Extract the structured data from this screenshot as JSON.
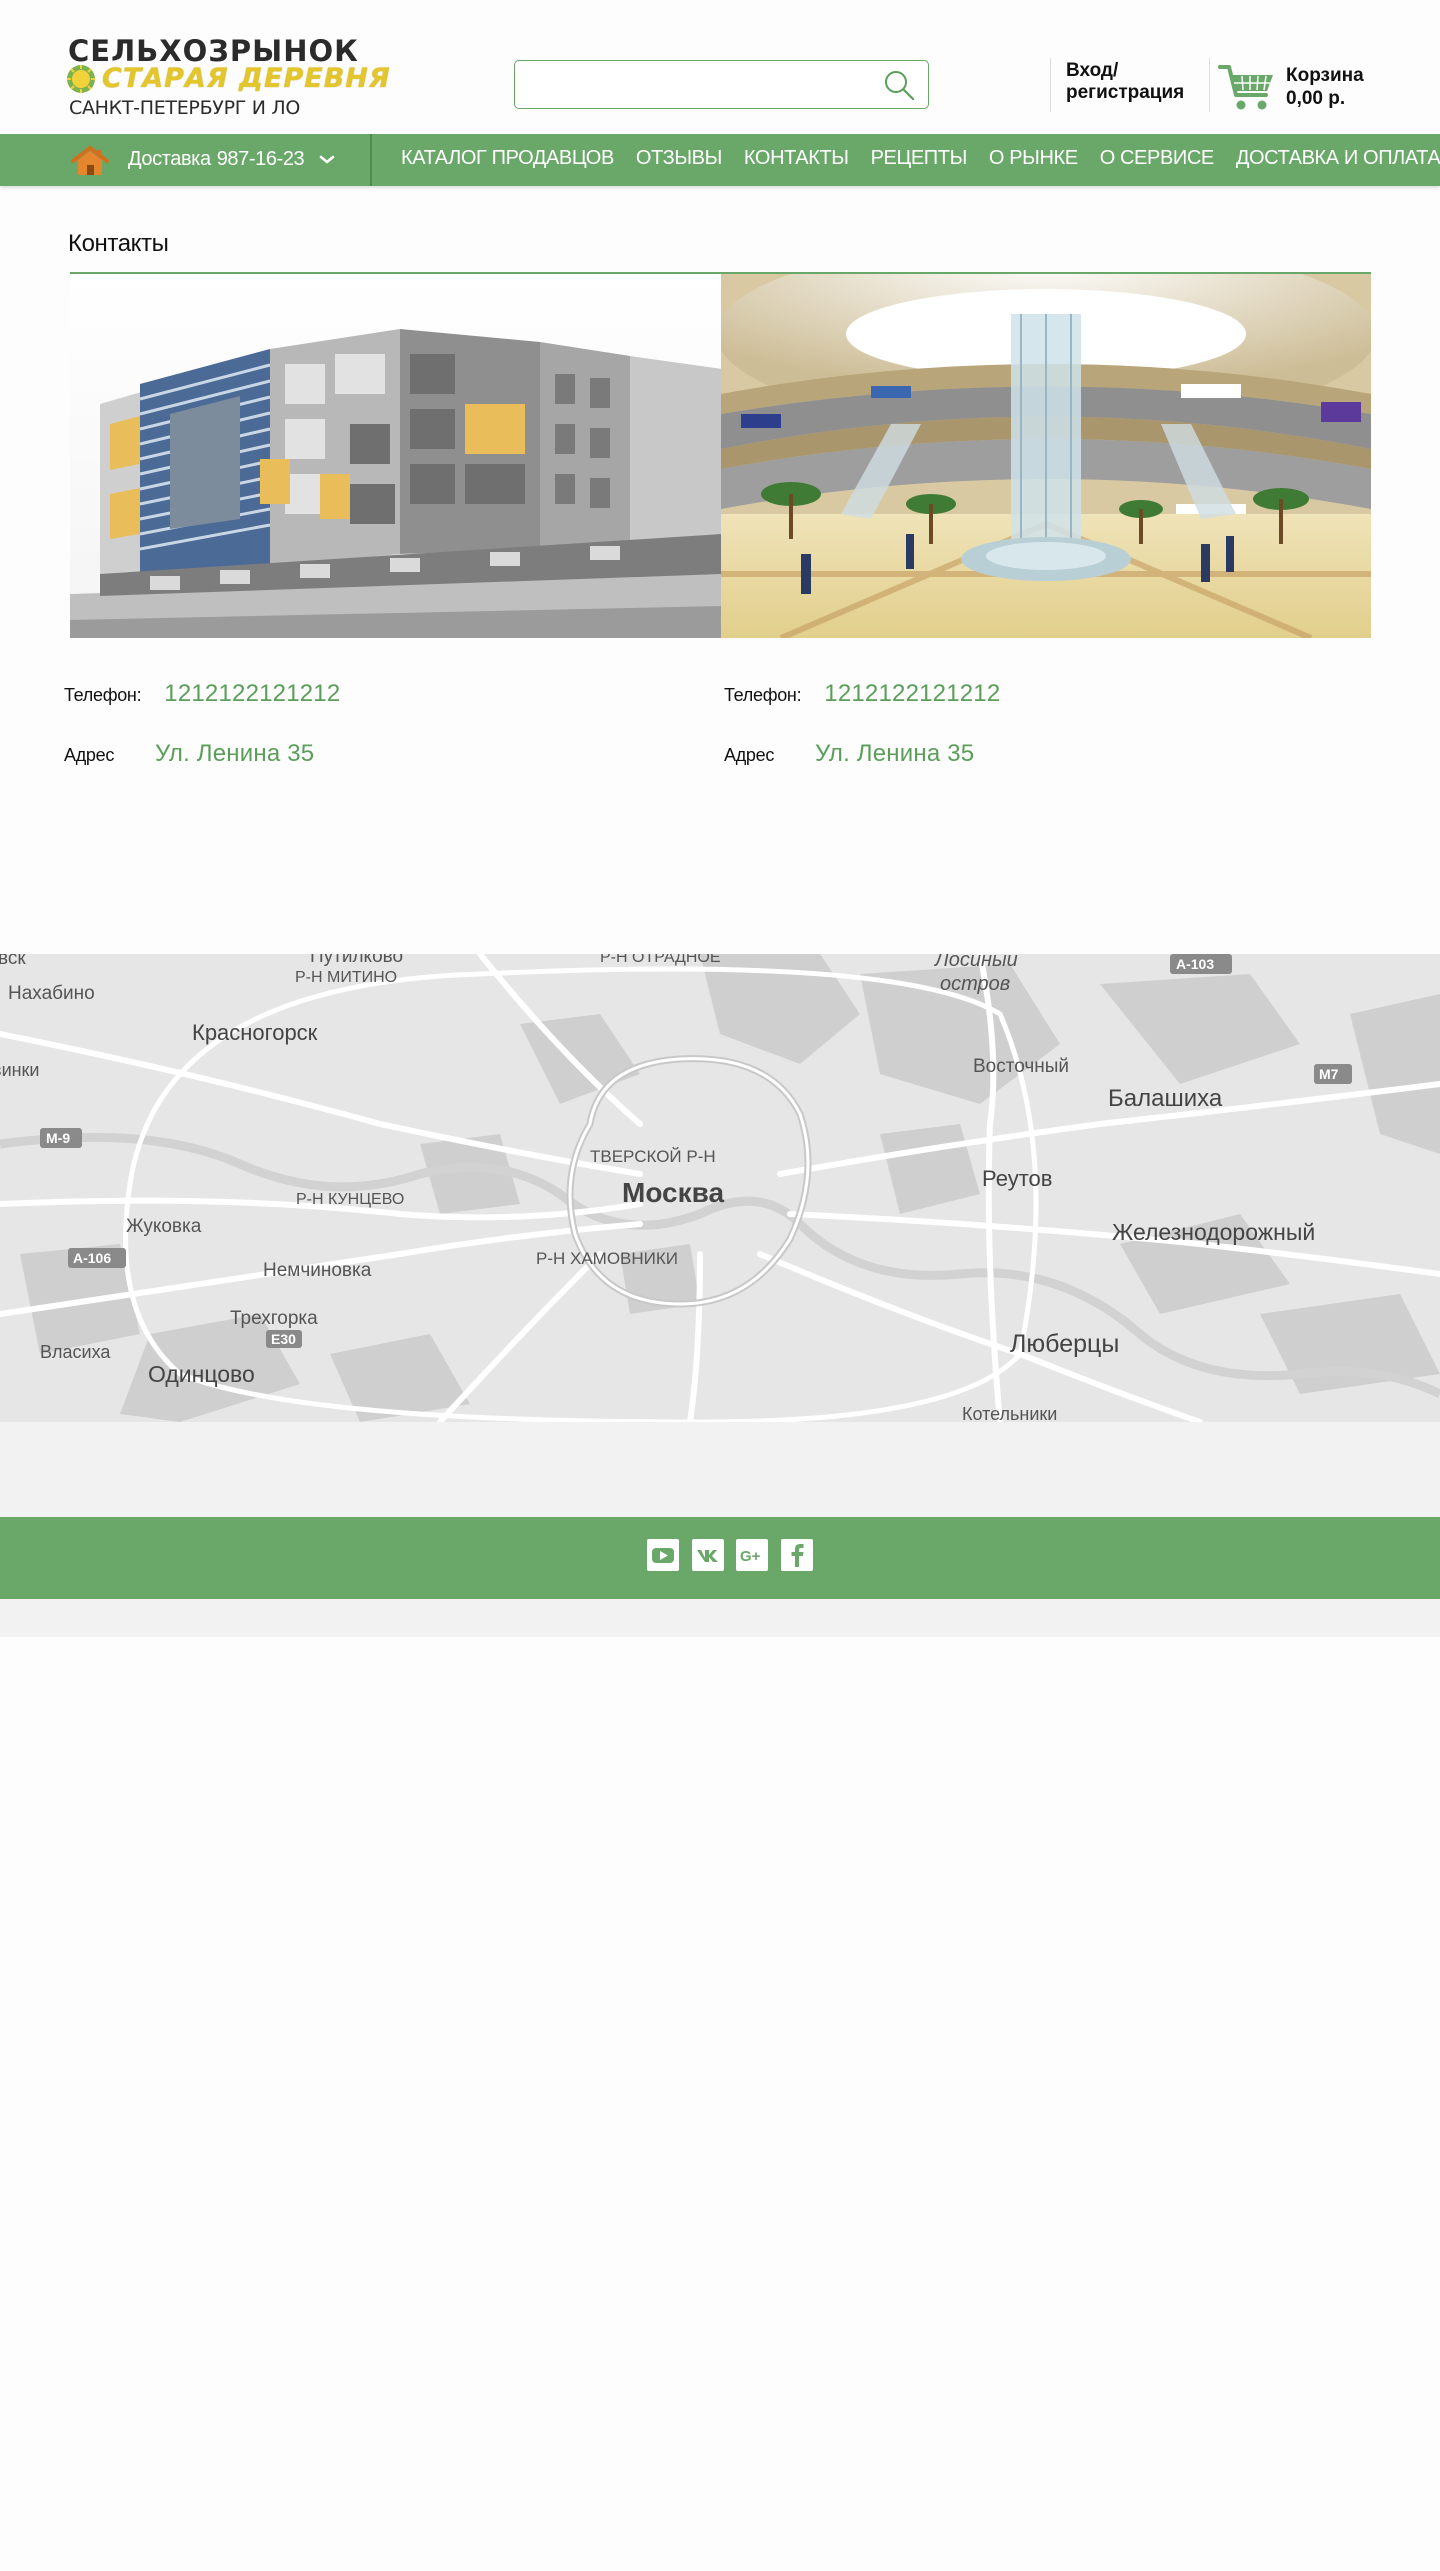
{
  "brand": {
    "line1": "СЕЛЬХОЗРЫНОК",
    "line2": "СТАРАЯ ДЕРЕВНЯ",
    "line3": "САНКТ-ПЕТЕРБУРГ И ЛО"
  },
  "search": {
    "value": "",
    "placeholder": ""
  },
  "account": {
    "line1": "Вход/",
    "line2": "регистрация"
  },
  "cart": {
    "label": "Корзина",
    "total": "0,00 р."
  },
  "delivery": {
    "label": "Доставка",
    "phone": "987-16-23"
  },
  "nav": {
    "items": [
      {
        "label": "КАТАЛОГ ПРОДАВЦОВ"
      },
      {
        "label": "ОТЗЫВЫ"
      },
      {
        "label": "КОНТАКТЫ"
      },
      {
        "label": "РЕЦЕПТЫ"
      },
      {
        "label": "О РЫНКЕ"
      },
      {
        "label": "О СЕРВИСЕ"
      },
      {
        "label": "ДОСТАВКА И ОПЛАТА"
      }
    ]
  },
  "page": {
    "title": "Контакты"
  },
  "contacts": [
    {
      "phone_label": "Телефон:",
      "phone": "1212122121212",
      "address_label": "Адрес",
      "address": "Ул. Ленина 35"
    },
    {
      "phone_label": "Телефон:",
      "phone": "1212122121212",
      "address_label": "Адрес",
      "address": "Ул. Ленина 35"
    }
  ],
  "map": {
    "labels": {
      "krasnogorsk": "Красногорск",
      "nakhabino": "Нахабино",
      "putilkovo": "Путилково",
      "mitino": "Р-Н МИТИНО",
      "otradnoe": "Р-Н ОТРАДНОЕ",
      "losiny1": "Лосиный",
      "losiny2": "остров",
      "a103": "А-103",
      "vostochny": "Восточный",
      "balashikha": "Балашиха",
      "m7": "M7",
      "m9": "М-9",
      "tverskoy": "ТВЕРСКОЙ Р-Н",
      "moskva": "Москва",
      "kuntsevo": "Р-Н КУНЦЕВО",
      "reutov": "Реутов",
      "zhukovka": "Жуковка",
      "zheleznodorozhny": "Железнодорожный",
      "a106": "А-106",
      "nemchinovka": "Немчиновка",
      "khamovniki": "Р-Н ХАМОВНИКИ",
      "trekhgorka": "Трехгорка",
      "e30": "E30",
      "vlasikha": "Власиха",
      "odintsovo": "Одинцово",
      "lyubertsy": "Люберцы",
      "kotelniki": "Котельники",
      "edge_vsk": "вск",
      "edge_inki": "винки"
    }
  },
  "social": [
    {
      "name": "youtube"
    },
    {
      "name": "vk"
    },
    {
      "name": "google-plus"
    },
    {
      "name": "facebook"
    }
  ],
  "colors": {
    "accent": "#6aa869",
    "link": "#5a9e59",
    "logo_yellow": "#e3c52c"
  }
}
